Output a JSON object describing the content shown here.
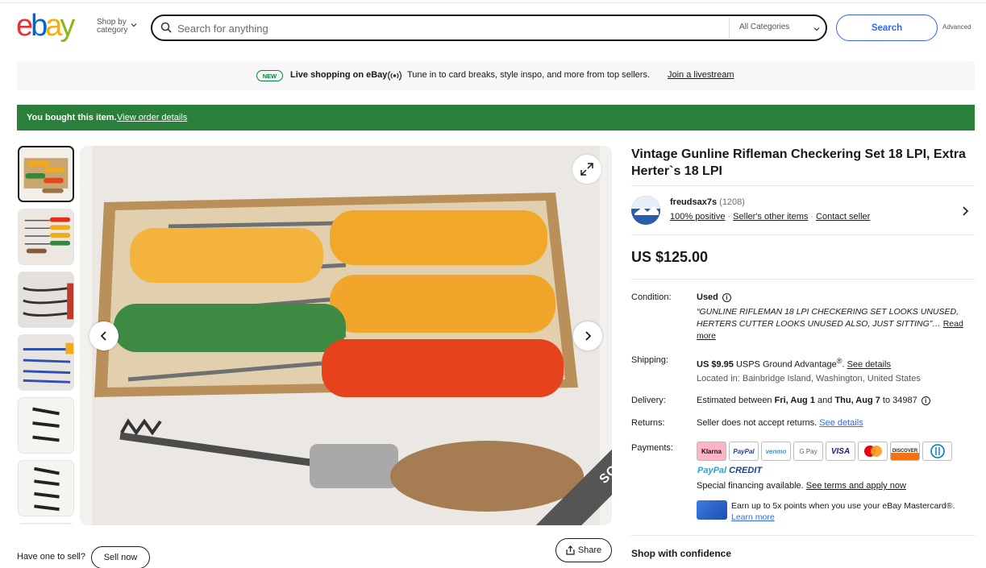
{
  "header": {
    "logo_text": "ebay",
    "shop_by": [
      "Shop by",
      "category"
    ],
    "search_placeholder": "Search for anything",
    "category_select": "All Categories",
    "search_button": "Search",
    "advanced": "Advanced"
  },
  "live_banner": {
    "badge": "NEW",
    "title": "Live shopping on eBay",
    "text": "Tune in to card breaks, style inspo, and more from top sellers.",
    "link": "Join a livestream"
  },
  "bought_banner": {
    "text": "You bought this item.",
    "link": "View order details"
  },
  "gallery": {
    "thumbnail_count": 7,
    "active_index": 0,
    "sold_label": "SOLD",
    "have_one": "Have one to sell?",
    "sell_now": "Sell now",
    "share": "Share"
  },
  "item": {
    "title": "Vintage Gunline Rifleman Checkering Set 18 LPI, Extra Herter`s 18 LPI",
    "seller": {
      "name": "freudsax7s",
      "count": "(1208)",
      "positive": "100% positive",
      "other_items": "Seller's other items",
      "contact": "Contact seller"
    },
    "price": "US $125.00",
    "condition": {
      "label": "Condition:",
      "value": "Used",
      "quote": "“GUNLINE RIFLEMAN 18 LPI CHECKERING SET LOOKS UNUSED, HERTERS CUTTER LOOKS UNUSED ALSO, JUST SITTING”",
      "read_more": "Read more"
    },
    "shipping": {
      "label": "Shipping:",
      "cost": "US $9.95",
      "method": "USPS Ground Advantage",
      "link": "See details",
      "location": "Located in: Bainbridge Island, Washington, United States"
    },
    "delivery": {
      "label": "Delivery:",
      "prefix": "Estimated between",
      "start": "Fri, Aug 1",
      "and": "and",
      "end": "Thu, Aug 7",
      "to": "to 34987"
    },
    "returns": {
      "label": "Returns:",
      "text": "Seller does not accept returns.",
      "link": "See details"
    },
    "payments": {
      "label": "Payments:",
      "methods": [
        "Klarna",
        "PayPal",
        "venmo",
        "G Pay",
        "VISA",
        "Mastercard",
        "DISCOVER",
        "Diners Club"
      ],
      "credit_a": "PayPal",
      "credit_b": " CREDIT",
      "financing": "Special financing available.",
      "financing_link": "See terms and apply now",
      "earn": "Earn up to 5x points when you use your eBay Mastercard®.",
      "learn_more": "Learn more"
    },
    "shop_confidence": "Shop with confidence"
  },
  "colors": {
    "ebay_red": "#e53238",
    "ebay_blue": "#0064d2",
    "ebay_yellow": "#f5af02",
    "ebay_green": "#86b817",
    "accent_blue": "#3665f3",
    "bought_green": "#2a7f3a"
  }
}
